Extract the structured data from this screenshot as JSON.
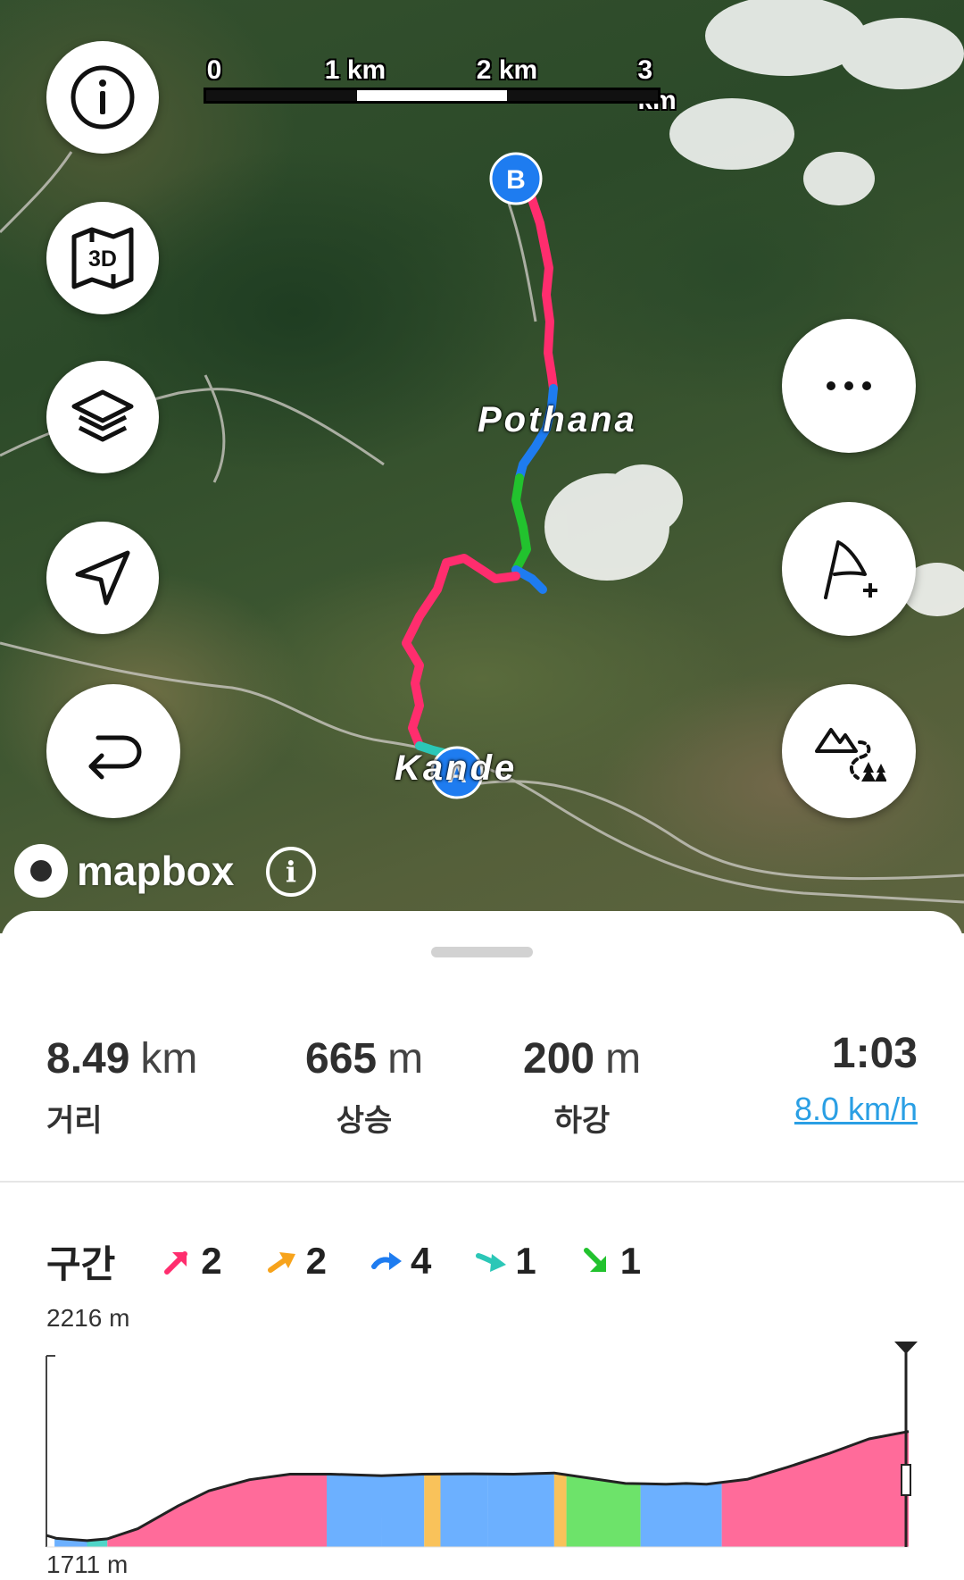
{
  "map": {
    "scale": {
      "labels": [
        "0",
        "1 km",
        "2 km",
        "3 km"
      ]
    },
    "place_labels": {
      "pothana": "Pothana",
      "kande": "Kande"
    },
    "markers": {
      "start": "A",
      "end": "B"
    },
    "attribution": {
      "logo_text": "mapbox",
      "info_glyph": "i"
    },
    "left_buttons": [
      {
        "name": "info-button",
        "icon": "info-icon"
      },
      {
        "name": "3d-map-button",
        "icon": "3d-map-icon",
        "text": "3D"
      },
      {
        "name": "layers-button",
        "icon": "layers-icon"
      },
      {
        "name": "locate-button",
        "icon": "navigation-arrow-icon"
      },
      {
        "name": "reverse-route-button",
        "icon": "u-turn-arrow-icon"
      }
    ],
    "right_buttons": [
      {
        "name": "more-button",
        "icon": "more-dots-icon"
      },
      {
        "name": "add-waypoint-button",
        "icon": "flag-plus-icon"
      },
      {
        "name": "trail-explore-button",
        "icon": "mountain-trail-icon"
      }
    ],
    "route_colors": {
      "steep_up": "#ff2d6e",
      "moderate_up": "#f7a31b",
      "flat": "#1e7cf0",
      "slight_down": "#2bc7b7",
      "steep_down": "#22c22e"
    }
  },
  "stats": {
    "distance": {
      "value": "8.49",
      "unit": "km",
      "label": "거리"
    },
    "ascent": {
      "value": "665",
      "unit": "m",
      "label": "상승"
    },
    "descent": {
      "value": "200",
      "unit": "m",
      "label": "하강"
    },
    "duration": {
      "value": "1:03",
      "speed": "8.0 km/h"
    }
  },
  "segments": {
    "title": "구간",
    "items": [
      {
        "icon": "steep-up-arrow-icon",
        "count": "2",
        "color": "#ff2d6e"
      },
      {
        "icon": "moderate-up-arrow-icon",
        "count": "2",
        "color": "#f7a31b"
      },
      {
        "icon": "flat-arrow-icon",
        "count": "4",
        "color": "#1e7cf0"
      },
      {
        "icon": "slight-down-arrow-icon",
        "count": "1",
        "color": "#2bc7b7"
      },
      {
        "icon": "steep-down-arrow-icon",
        "count": "1",
        "color": "#22c22e"
      }
    ]
  },
  "chart_data": {
    "type": "area",
    "title": "",
    "xlabel": "",
    "ylabel": "",
    "ylim": [
      1711,
      2216
    ],
    "y_labels": {
      "max": "2216 m",
      "min": "1711 m"
    },
    "xlim": [
      0,
      8.49
    ],
    "x": [
      0,
      0.1,
      0.4,
      0.6,
      0.9,
      1.3,
      1.6,
      2.0,
      2.4,
      2.8,
      3.3,
      3.7,
      4.2,
      4.6,
      5.0,
      5.4,
      5.7,
      5.9,
      6.1,
      6.3,
      6.5,
      6.9,
      7.3,
      7.7,
      8.1,
      8.49
    ],
    "y": [
      1742,
      1734,
      1728,
      1733,
      1760,
      1822,
      1862,
      1892,
      1907,
      1907,
      1903,
      1907,
      1908,
      1907,
      1910,
      1894,
      1882,
      1881,
      1880,
      1882,
      1880,
      1893,
      1926,
      1962,
      2002,
      2022
    ],
    "segments": [
      {
        "type": "flat",
        "from": 0.08,
        "to": 0.4,
        "color": "#6cb0ff"
      },
      {
        "type": "slight_down",
        "from": 0.4,
        "to": 0.6,
        "color": "#4fd5c8"
      },
      {
        "type": "steep_up",
        "from": 0.6,
        "to": 2.76,
        "color": "#ff6b9a"
      },
      {
        "type": "flat",
        "from": 2.76,
        "to": 3.3,
        "color": "#6cb0ff"
      },
      {
        "type": "flat",
        "from": 3.3,
        "to": 3.72,
        "color": "#6cb0ff"
      },
      {
        "type": "moderate_up",
        "from": 3.72,
        "to": 3.88,
        "color": "#f9c25a"
      },
      {
        "type": "flat",
        "from": 3.88,
        "to": 4.35,
        "color": "#6cb0ff"
      },
      {
        "type": "flat",
        "from": 4.35,
        "to": 5.0,
        "color": "#6cb0ff"
      },
      {
        "type": "moderate_up",
        "from": 5.0,
        "to": 5.12,
        "color": "#f9c25a"
      },
      {
        "type": "steep_down",
        "from": 5.12,
        "to": 5.85,
        "color": "#6de36a"
      },
      {
        "type": "flat",
        "from": 5.85,
        "to": 6.65,
        "color": "#6cb0ff"
      },
      {
        "type": "steep_up",
        "from": 6.65,
        "to": 8.49,
        "color": "#ff6b9a"
      }
    ]
  }
}
